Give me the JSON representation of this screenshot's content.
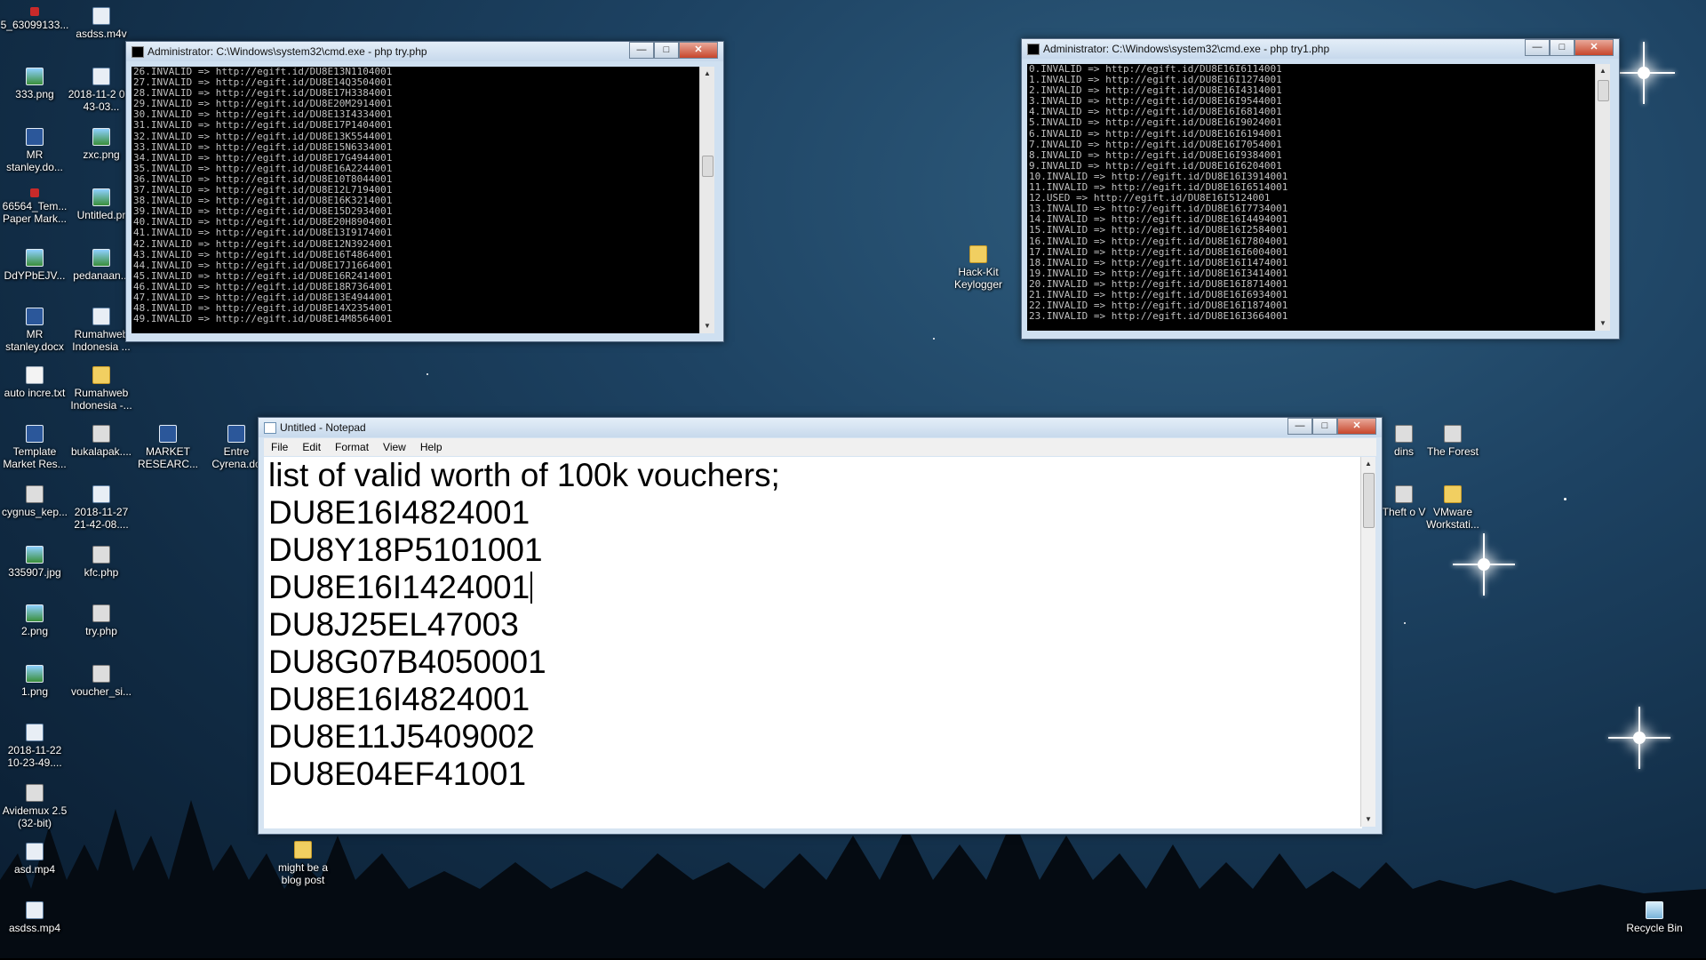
{
  "desktop": {
    "icons": [
      {
        "label": "5_63099133...",
        "glyph": "g-red"
      },
      {
        "label": "asdss.m4v",
        "glyph": "g-media"
      },
      {
        "label": "333.png",
        "glyph": "g-img"
      },
      {
        "label": "2018-11-2 09-43-03...",
        "glyph": "g-media"
      },
      {
        "label": "MR stanley.do...",
        "glyph": "g-doc"
      },
      {
        "label": "zxc.png",
        "glyph": "g-img"
      },
      {
        "label": "66564_Tem... Paper Mark...",
        "glyph": "g-red"
      },
      {
        "label": "Untitled.pr",
        "glyph": "g-img"
      },
      {
        "label": "DdYPbEJV...",
        "glyph": "g-img"
      },
      {
        "label": "pedanaan...",
        "glyph": "g-img"
      },
      {
        "label": "MR stanley.docx",
        "glyph": "g-doc"
      },
      {
        "label": "Rumahweb Indonesia ...",
        "glyph": "g-media"
      },
      {
        "label": "auto incre.txt",
        "glyph": "g-file"
      },
      {
        "label": "Rumahweb Indonesia -...",
        "glyph": "g-folder"
      },
      {
        "label": "Template Market Res...",
        "glyph": "g-doc"
      },
      {
        "label": "bukalapak....",
        "glyph": "g-exe"
      },
      {
        "label": "MARKET RESEARC...",
        "glyph": "g-doc"
      },
      {
        "label": "Entre Cyrena.do",
        "glyph": "g-doc"
      },
      {
        "label": "cygnus_kep...",
        "glyph": "g-exe"
      },
      {
        "label": "2018-11-27 21-42-08....",
        "glyph": "g-media"
      },
      {
        "label": "335907.jpg",
        "glyph": "g-img"
      },
      {
        "label": "kfc.php",
        "glyph": "g-exe"
      },
      {
        "label": "2.png",
        "glyph": "g-img"
      },
      {
        "label": "try.php",
        "glyph": "g-exe"
      },
      {
        "label": "1.png",
        "glyph": "g-img"
      },
      {
        "label": "voucher_si...",
        "glyph": "g-exe"
      },
      {
        "label": "2018-11-22 10-23-49....",
        "glyph": "g-media"
      },
      {
        "label": "Avidemux 2.5 (32-bit)",
        "glyph": "g-exe"
      },
      {
        "label": "asd.mp4",
        "glyph": "g-media"
      },
      {
        "label": "asdss.mp4",
        "glyph": "g-media"
      },
      {
        "label": "might be a blog post",
        "glyph": "g-folder"
      },
      {
        "label": "Hack-Kit Keylogger",
        "glyph": "g-folder"
      },
      {
        "label": "dins",
        "glyph": "g-exe"
      },
      {
        "label": "The Forest",
        "glyph": "g-exe"
      },
      {
        "label": "Theft o V",
        "glyph": "g-exe"
      },
      {
        "label": "VMware Workstati...",
        "glyph": "g-folder"
      },
      {
        "label": "Recycle Bin",
        "glyph": "g-bin"
      }
    ]
  },
  "cmd_left": {
    "title": "Administrator: C:\\Windows\\system32\\cmd.exe - php  try.php",
    "lines": [
      "26.INVALID => http://egift.id/DU8E13N1104001",
      "27.INVALID => http://egift.id/DU8E14Q3504001",
      "28.INVALID => http://egift.id/DU8E17H3384001",
      "29.INVALID => http://egift.id/DU8E20M2914001",
      "30.INVALID => http://egift.id/DU8E13I4334001",
      "31.INVALID => http://egift.id/DU8E17P1404001",
      "32.INVALID => http://egift.id/DU8E13K5544001",
      "33.INVALID => http://egift.id/DU8E15N6334001",
      "34.INVALID => http://egift.id/DU8E17G4944001",
      "35.INVALID => http://egift.id/DU8E16A2244001",
      "36.INVALID => http://egift.id/DU8E10T8044001",
      "37.INVALID => http://egift.id/DU8E12L7194001",
      "38.INVALID => http://egift.id/DU8E16K3214001",
      "39.INVALID => http://egift.id/DU8E15D2934001",
      "40.INVALID => http://egift.id/DU8E20H8904001",
      "41.INVALID => http://egift.id/DU8E13I9174001",
      "42.INVALID => http://egift.id/DU8E12N3924001",
      "43.INVALID => http://egift.id/DU8E16T4864001",
      "44.INVALID => http://egift.id/DU8E17J1664001",
      "45.INVALID => http://egift.id/DU8E16R2414001",
      "46.INVALID => http://egift.id/DU8E18R7364001",
      "47.INVALID => http://egift.id/DU8E13E4944001",
      "48.INVALID => http://egift.id/DU8E14X2354001",
      "49.INVALID => http://egift.id/DU8E14M8564001"
    ]
  },
  "cmd_right": {
    "title": "Administrator: C:\\Windows\\system32\\cmd.exe - php  try1.php",
    "lines": [
      "0.INVALID => http://egift.id/DU8E16I6114001",
      "1.INVALID => http://egift.id/DU8E16I1274001",
      "2.INVALID => http://egift.id/DU8E16I4314001",
      "3.INVALID => http://egift.id/DU8E16I9544001",
      "4.INVALID => http://egift.id/DU8E16I6814001",
      "5.INVALID => http://egift.id/DU8E16I9024001",
      "6.INVALID => http://egift.id/DU8E16I6194001",
      "7.INVALID => http://egift.id/DU8E16I7054001",
      "8.INVALID => http://egift.id/DU8E16I9384001",
      "9.INVALID => http://egift.id/DU8E16I6204001",
      "10.INVALID => http://egift.id/DU8E16I3914001",
      "11.INVALID => http://egift.id/DU8E16I6514001",
      "12.USED => http://egift.id/DU8E16I5124001",
      "13.INVALID => http://egift.id/DU8E16I7734001",
      "14.INVALID => http://egift.id/DU8E16I4494001",
      "15.INVALID => http://egift.id/DU8E16I2584001",
      "16.INVALID => http://egift.id/DU8E16I7804001",
      "17.INVALID => http://egift.id/DU8E16I6004001",
      "18.INVALID => http://egift.id/DU8E16I1474001",
      "19.INVALID => http://egift.id/DU8E16I3414001",
      "20.INVALID => http://egift.id/DU8E16I8714001",
      "21.INVALID => http://egift.id/DU8E16I6934001",
      "22.INVALID => http://egift.id/DU8E16I1874001",
      "23.INVALID => http://egift.id/DU8E16I3664001"
    ]
  },
  "notepad": {
    "title": "Untitled - Notepad",
    "menu": [
      "File",
      "Edit",
      "Format",
      "View",
      "Help"
    ],
    "lines": [
      "list of valid worth of 100k vouchers;",
      "DU8E16I4824001",
      "DU8Y18P5101001",
      "DU8E16I1424001",
      "DU8J25EL47003",
      "DU8G07B4050001",
      "DU8E16I4824001",
      "DU8E11J5409002",
      "DU8E04EF41001"
    ],
    "caret_line": 3
  },
  "window_controls": {
    "minimize": "—",
    "maximize": "□",
    "close": "✕"
  }
}
